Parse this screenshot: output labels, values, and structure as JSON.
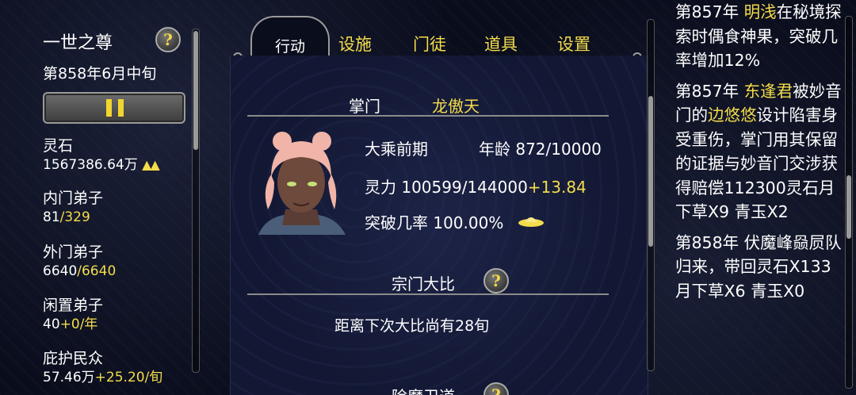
{
  "app": {
    "title": "一世之尊",
    "date": "第858年6月中旬"
  },
  "help_symbol": "?",
  "pause_symbol": "II",
  "stats": [
    {
      "label": "灵石",
      "value": "1567386.64万",
      "suffix": "",
      "trend": "▲▲"
    },
    {
      "label": "内门弟子",
      "value": "81",
      "suffix": "/329",
      "trend": ""
    },
    {
      "label": "外门弟子",
      "value": "6640",
      "suffix": "/6640",
      "trend": ""
    },
    {
      "label": "闲置弟子",
      "value": "40",
      "suffix": "+0/年",
      "trend": ""
    },
    {
      "label": "庇护民众",
      "value": "57.46万",
      "suffix": "+25.20/旬",
      "trend": ""
    }
  ],
  "tabs": {
    "active": "行动",
    "items": [
      "设施",
      "门徒",
      "道具",
      "设置"
    ]
  },
  "leader": {
    "label": "掌门",
    "name": "龙傲天",
    "realm": "大乘前期",
    "age_label": "年龄",
    "age_value": "872/10000",
    "power_label": "灵力",
    "power_value": "100599/144000",
    "power_rate": "+13.84",
    "breakthrough_label": "突破几率",
    "breakthrough_value": "100.00%"
  },
  "tournament": {
    "title": "宗门大比",
    "text": "距离下次大比尚有28旬"
  },
  "next_section": {
    "title": "除魔卫道"
  },
  "log": [
    {
      "parts": [
        {
          "t": "第857年 ",
          "c": ""
        },
        {
          "t": "明浅",
          "c": "yellow"
        },
        {
          "t": "在秘境探索时偶食神果，突破几率增加12%",
          "c": ""
        }
      ]
    },
    {
      "parts": [
        {
          "t": "第857年 ",
          "c": ""
        },
        {
          "t": "东逢君",
          "c": "yellow"
        },
        {
          "t": "被妙音门的",
          "c": ""
        },
        {
          "t": "边悠悠",
          "c": "yellow"
        },
        {
          "t": "设计陷害身受重伤，掌门用其保留的证据与妙音门交涉获得赔偿112300灵石月下草X9 青玉X2",
          "c": ""
        }
      ]
    },
    {
      "parts": [
        {
          "t": "第858年 伏魔峰",
          "c": ""
        },
        {
          "t": "赑屃",
          "c": ""
        },
        {
          "t": "队归来，带回灵石X133月下草X6 青玉X0",
          "c": ""
        }
      ]
    }
  ],
  "colors": {
    "accent_yellow": "#f3dc4b",
    "background": "#0a0d1c",
    "panel": "#121733"
  }
}
